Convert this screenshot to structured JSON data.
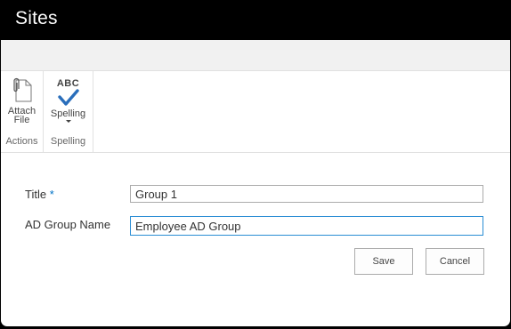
{
  "window": {
    "title": "Sites"
  },
  "ribbon": {
    "groups": [
      {
        "label": "Actions",
        "buttons": [
          {
            "label_line1": "Attach",
            "label_line2": "File",
            "icon": "paperclip-document-icon"
          }
        ]
      },
      {
        "label": "Spelling",
        "buttons": [
          {
            "abc_text": "ABC",
            "label": "Spelling",
            "icon": "spelling-check-icon",
            "has_dropdown": true
          }
        ]
      }
    ]
  },
  "form": {
    "title_label": "Title",
    "required_marker": "*",
    "title_value": "Group 1",
    "ad_group_label": "AD Group Name",
    "ad_group_value": "Employee AD Group"
  },
  "buttons": {
    "save": "Save",
    "cancel": "Cancel"
  },
  "colors": {
    "title_bar": "#000000",
    "focus_border": "#2a8dd4",
    "checkmark": "#2a6ebb",
    "required": "#0072c6"
  }
}
